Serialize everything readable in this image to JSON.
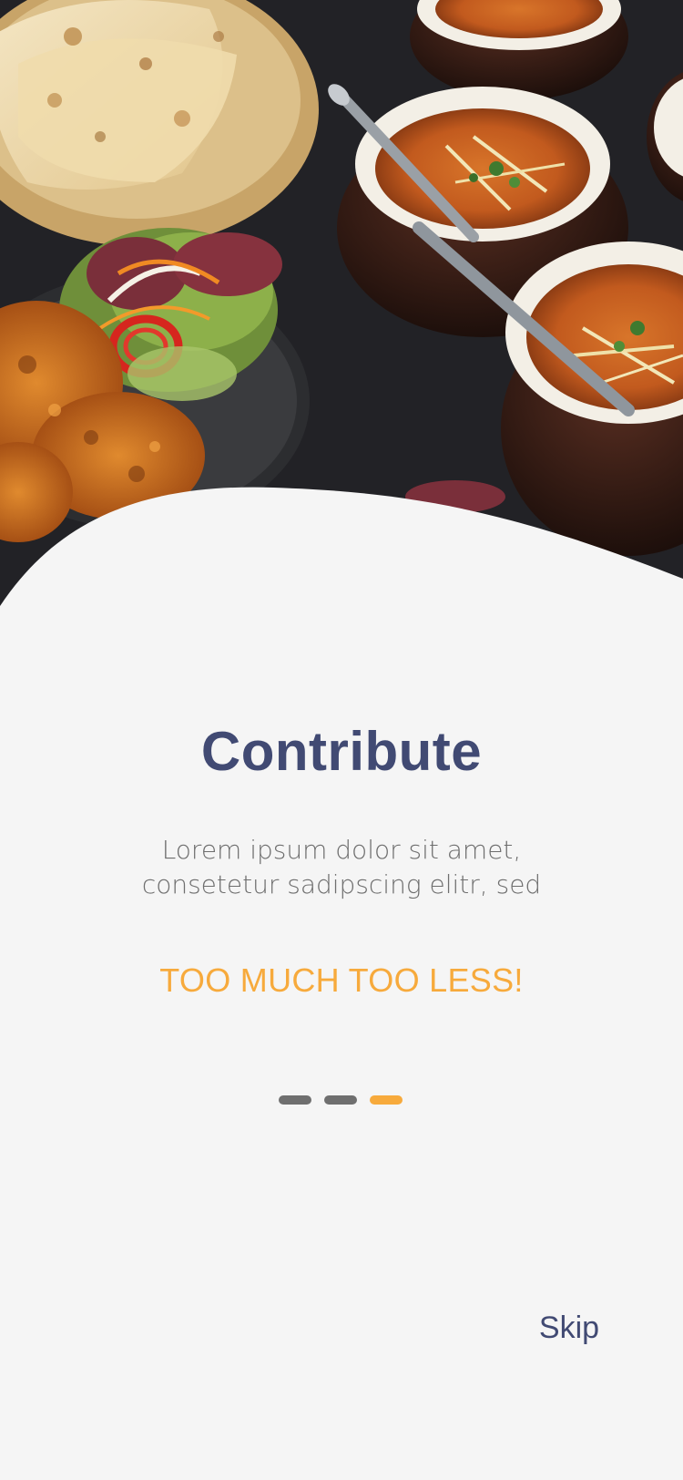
{
  "onboarding": {
    "title": "Contribute",
    "description_line1": "Lorem ipsum dolor sit amet,",
    "description_line2": "consetetur sadipscing elitr, sed",
    "tagline": "TOO MUCH TOO LESS!",
    "pager": {
      "total": 3,
      "active_index": 2
    },
    "skip_label": "Skip"
  },
  "colors": {
    "title": "#414a73",
    "description": "#6e6e6e",
    "accent": "#f7aa3c",
    "indicator_inactive": "#6f6f6f",
    "background": "#f5f5f5"
  }
}
